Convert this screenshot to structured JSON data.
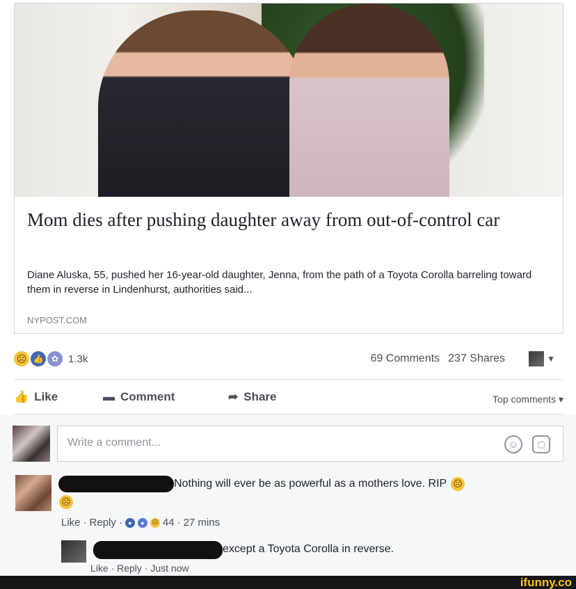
{
  "post": {
    "headline": "Mom dies after pushing daughter away from out-of-control car",
    "description": "Diane Aluska, 55, pushed her 16-year-old daughter, Jenna, from the path of a Toyota Corolla barreling toward them in reverse in Lindenhurst, authorities said...",
    "source": "NYPOST.COM"
  },
  "stats": {
    "reaction_count": "1.3k",
    "comments": "69 Comments",
    "shares": "237 Shares",
    "reactions": [
      "sad-emoji-icon",
      "like-reaction-icon",
      "care-reaction-icon"
    ]
  },
  "actions": {
    "like": "Like",
    "comment": "Comment",
    "share": "Share",
    "sort": "Top comments"
  },
  "composer": {
    "placeholder": "Write a comment..."
  },
  "comments": [
    {
      "text": "Nothing will ever be as powerful as a mothers love. RIP",
      "meta": {
        "like": "Like",
        "reply": "Reply",
        "reaction_count": "44",
        "time": "27 mins"
      }
    },
    {
      "text": "except a Toyota Corolla in reverse.",
      "meta": "Like · Reply · Just now"
    }
  ],
  "watermark": "ifunny.co"
}
